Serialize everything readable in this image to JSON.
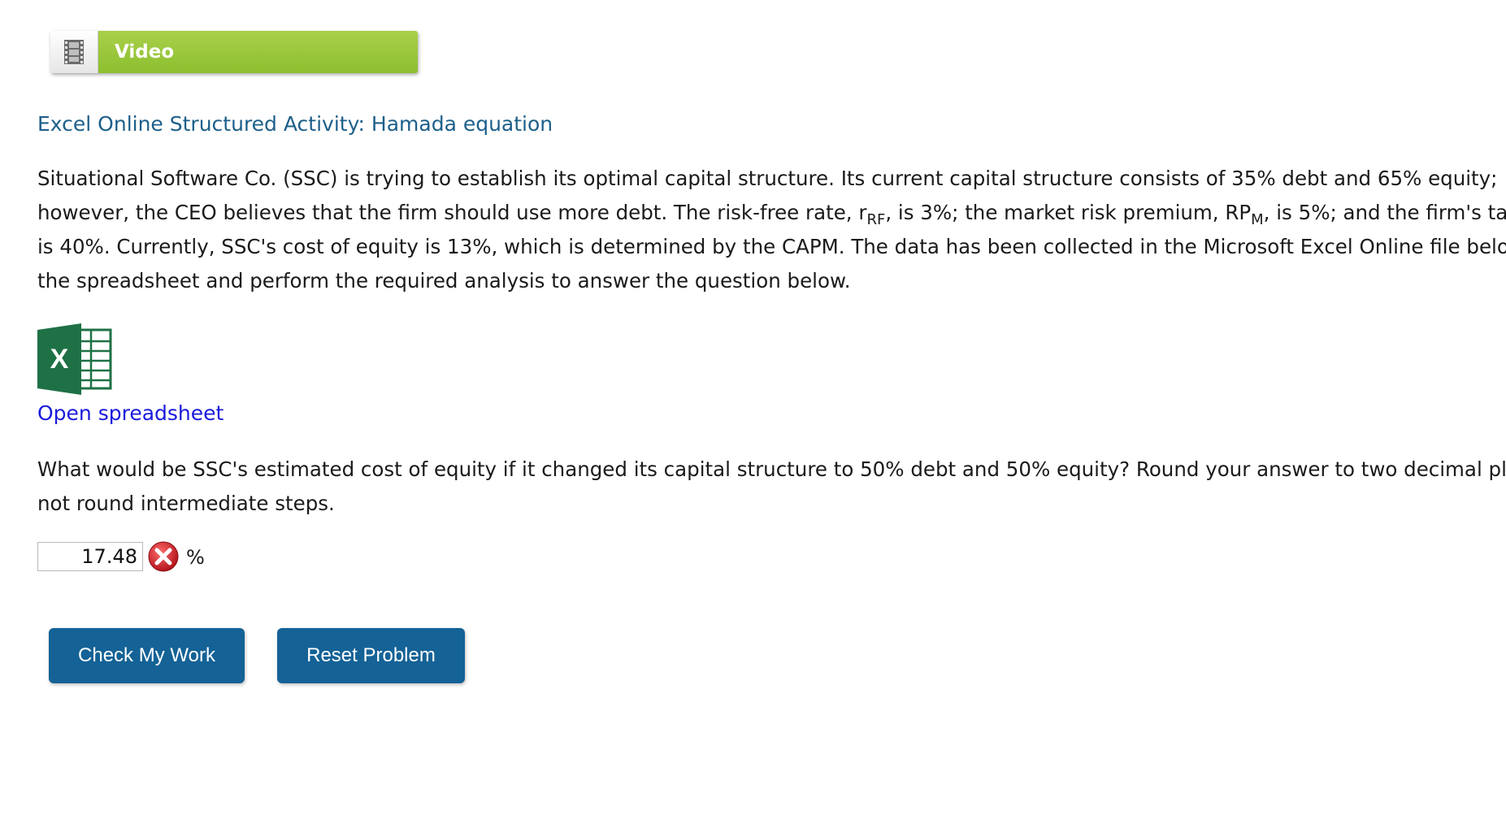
{
  "video": {
    "label": "Video",
    "icon": "film-strip-icon"
  },
  "activity": {
    "title": "Excel Online Structured Activity: Hamada equation"
  },
  "problem": {
    "line1": "Situational Software Co. (SSC) is trying to establish its optimal capital structure. Its current capital structure consists of 35% debt and 65% equity;",
    "line2_a": "however, the CEO believes that the firm should use more debt. The risk-free rate, r",
    "line2_sub1": "RF",
    "line2_b": ", is 3%; the market risk premium, RP",
    "line2_sub2": "M",
    "line2_c": ", is 5%; and the firm's ta",
    "line3": "is 40%. Currently, SSC's cost of equity is 13%, which is determined by the CAPM. The data has been collected in the Microsoft Excel Online file below",
    "line4": "the spreadsheet and perform the required analysis to answer the question below."
  },
  "spreadsheet": {
    "icon": "excel-icon",
    "link_label": "Open spreadsheet"
  },
  "question": {
    "line1": "What would be SSC's estimated cost of equity if it changed its capital structure to 50% debt and 50% equity? Round your answer to two decimal plac",
    "line2": "not round intermediate steps."
  },
  "answer": {
    "value": "17.48",
    "status_icon": "incorrect-x-icon",
    "unit": "%"
  },
  "buttons": {
    "check_label": "Check My Work",
    "reset_label": "Reset Problem",
    "color": "#146296"
  },
  "colors": {
    "title": "#1d5f8a",
    "link": "#1a1adc",
    "video_green": "#8cbf2f"
  }
}
